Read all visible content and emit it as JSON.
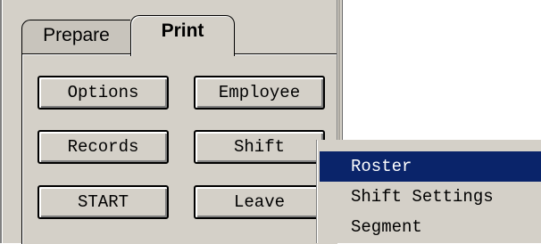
{
  "tabs": [
    {
      "label": "Prepare",
      "active": false
    },
    {
      "label": "Print",
      "active": true
    }
  ],
  "buttons": {
    "options": "Options",
    "employee": "Employee",
    "records": "Records",
    "shift": "Shift",
    "start": "START",
    "leave": "Leave"
  },
  "context_menu": {
    "items": [
      {
        "label": "Roster",
        "selected": true
      },
      {
        "label": "Shift Settings",
        "selected": false
      },
      {
        "label": "Segment",
        "selected": false
      }
    ]
  },
  "colors": {
    "face": "#d4d0c8",
    "selection": "#0a246a"
  }
}
